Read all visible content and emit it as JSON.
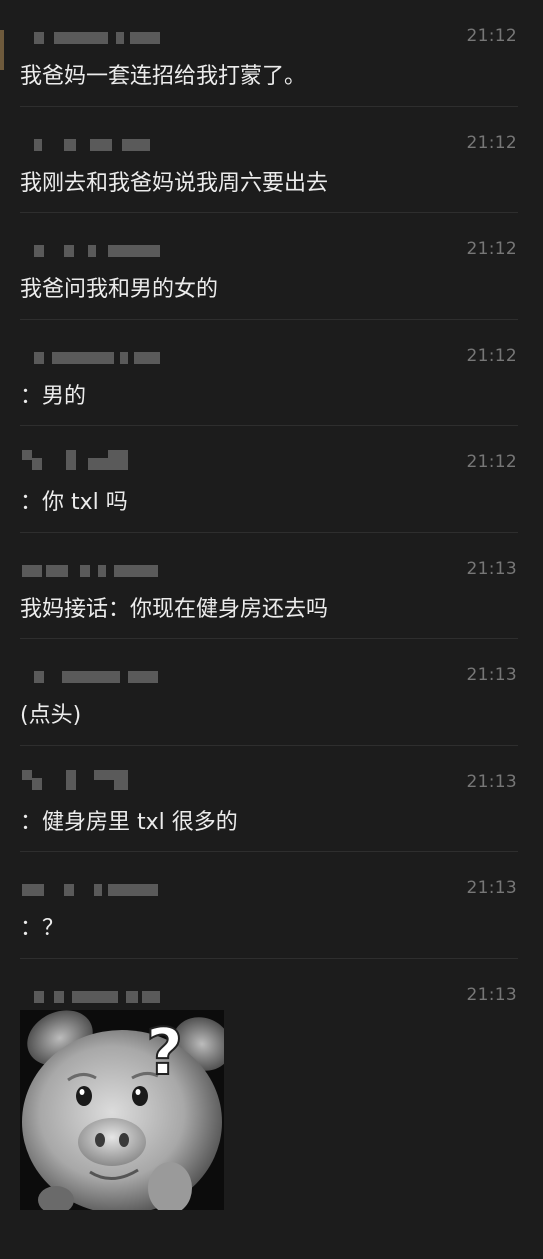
{
  "messages": [
    {
      "time": "21:12",
      "text": "我爸妈一套连招给我打蒙了。"
    },
    {
      "time": "21:12",
      "text": "我刚去和我爸妈说我周六要出去"
    },
    {
      "time": "21:12",
      "text": "我爸问我和男的女的"
    },
    {
      "time": "21:12",
      "text": "：男的"
    },
    {
      "time": "21:12",
      "text": "：你 txl 吗"
    },
    {
      "time": "21:13",
      "text": "我妈接话：你现在健身房还去吗"
    },
    {
      "time": "21:13",
      "text": "(点头)"
    },
    {
      "time": "21:13",
      "text": "：健身房里 txl 很多的"
    },
    {
      "time": "21:13",
      "text": "：？"
    }
  ],
  "last_message": {
    "time": "21:13",
    "sticker_icon": "confused-pig-sticker"
  },
  "colors": {
    "background": "#1c1c1c",
    "text": "#ececec",
    "time": "#777777",
    "divider": "#2e2e2e"
  }
}
